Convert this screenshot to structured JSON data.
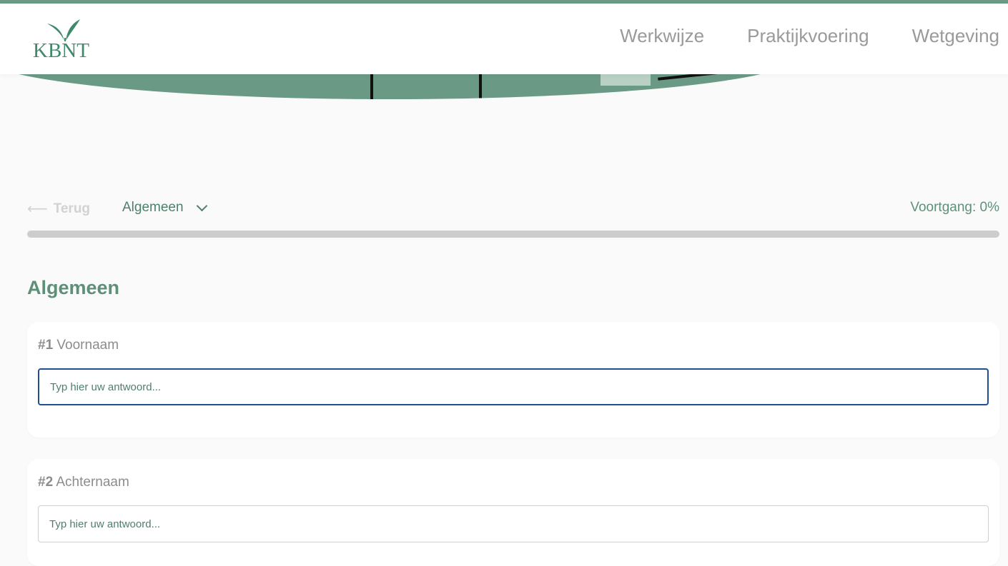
{
  "header": {
    "logo_text": "KBNT",
    "nav": [
      "Werkwijze",
      "Praktijkvoering",
      "Wetgeving"
    ]
  },
  "toolbar": {
    "back_label": "Terug",
    "section_label": "Algemeen",
    "progress_label": "Voortgang: 0%",
    "progress_percent": 0
  },
  "section": {
    "title": "Algemeen"
  },
  "questions": [
    {
      "num": "#1",
      "label": "Voornaam",
      "placeholder": "Typ hier uw antwoord..."
    },
    {
      "num": "#2",
      "label": "Achternaam",
      "placeholder": "Typ hier uw antwoord..."
    }
  ],
  "colors": {
    "brand_green": "#6a9a86",
    "focus_blue": "#1f4f92"
  }
}
